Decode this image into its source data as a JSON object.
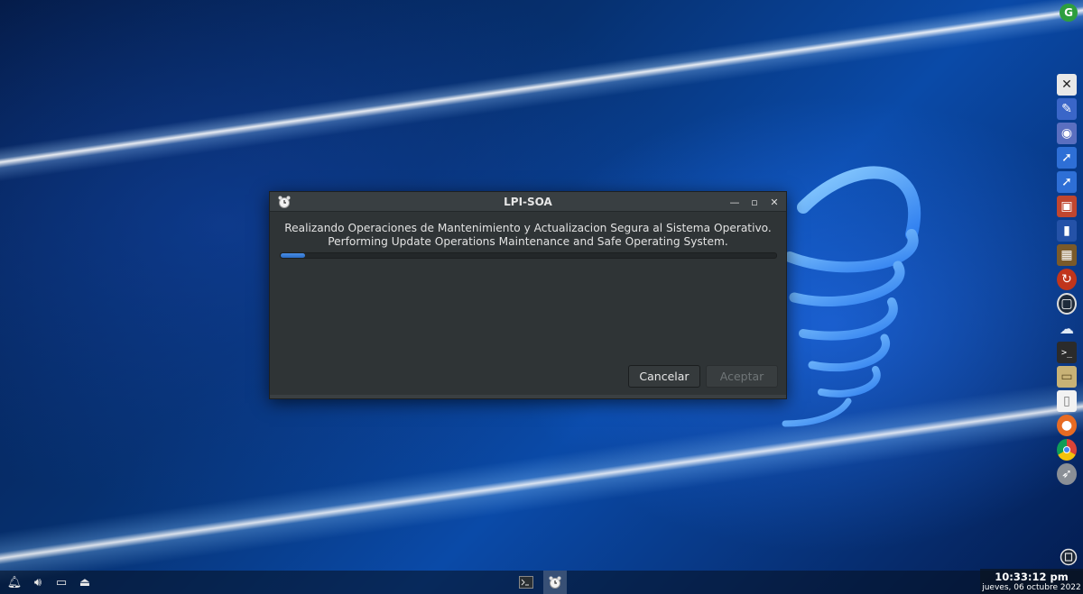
{
  "desktop": {
    "top_right_icon": "g-circle-icon",
    "dock_icons": [
      "x-window-icon",
      "document-write-icon",
      "disk-tools-icon",
      "cursor-arrow-icon",
      "cursor-arrow-alt-icon",
      "package-installer-icon",
      "vertical-bars-icon",
      "grid-app-icon",
      "recycle-orange-icon",
      "trash-circle-icon",
      "cloud-icon",
      "terminal-icon",
      "folder-icon",
      "file-icon",
      "firefox-icon",
      "chrome-icon",
      "rocket-icon"
    ]
  },
  "dialog": {
    "title": "LPI-SOA",
    "message_line1": "Realizando Operaciones de Mantenimiento y Actualizacion Segura al Sistema Operativo.",
    "message_line2": "Performing Update Operations Maintenance and Safe Operating System.",
    "progress": 0.05,
    "cancel_label": "Cancelar",
    "accept_label": "Aceptar"
  },
  "taskbar": {
    "tray_icons": [
      "notification-bell-icon",
      "volume-icon",
      "display-icon",
      "eject-icon"
    ],
    "tasks": [
      {
        "name": "terminal-task-icon",
        "active": false
      },
      {
        "name": "lpi-soa-task-icon",
        "active": true
      }
    ],
    "clock_time": "10:33:12 pm",
    "clock_date": "jueves, 06 octubre 2022"
  }
}
